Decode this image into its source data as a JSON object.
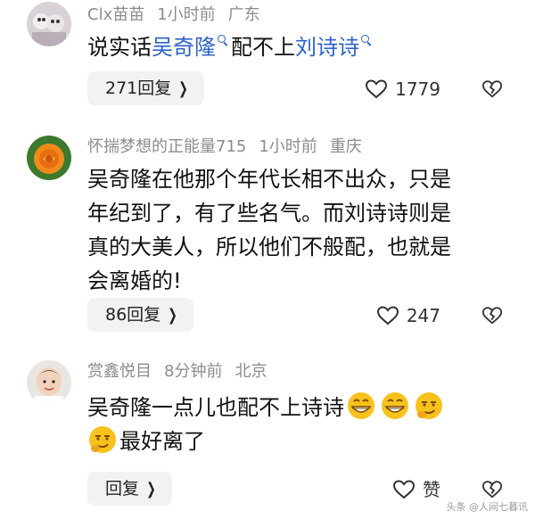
{
  "comments": [
    {
      "user": "Clx苗苗",
      "time": "1小时前",
      "location": "广东",
      "text_parts": [
        "说实话",
        "吴奇隆",
        "配不上",
        "刘诗诗"
      ],
      "reply_label": "271回复",
      "likes": "1779"
    },
    {
      "user": "怀揣梦想的正能量715",
      "time": "1小时前",
      "location": "重庆",
      "lines": [
        "吴奇隆在他那个年代长相不出众，只是",
        "年纪到了，有了些名气。而刘诗诗则是",
        "真的大美人，所以他们不般配，也就是",
        "会离婚的!"
      ],
      "reply_label": "86回复",
      "likes": "247"
    },
    {
      "user": "赏鑫悦目",
      "time": "8分钟前",
      "location": "北京",
      "line1": "吴奇隆一点儿也配不上诗诗",
      "line2": "最好离了",
      "reply_label": "回复",
      "likes": "赞"
    }
  ],
  "watermark": "头条 @人间七暮讯",
  "icons": {
    "like": "heart-outline-icon",
    "dislike": "broken-heart-icon",
    "search_suggest": "search-icon",
    "chevron": "chevron-right-icon"
  },
  "colors": {
    "highlight": "#2e63c8",
    "meta": "#8c8c8c",
    "reply_bg": "#f2f2f2"
  }
}
